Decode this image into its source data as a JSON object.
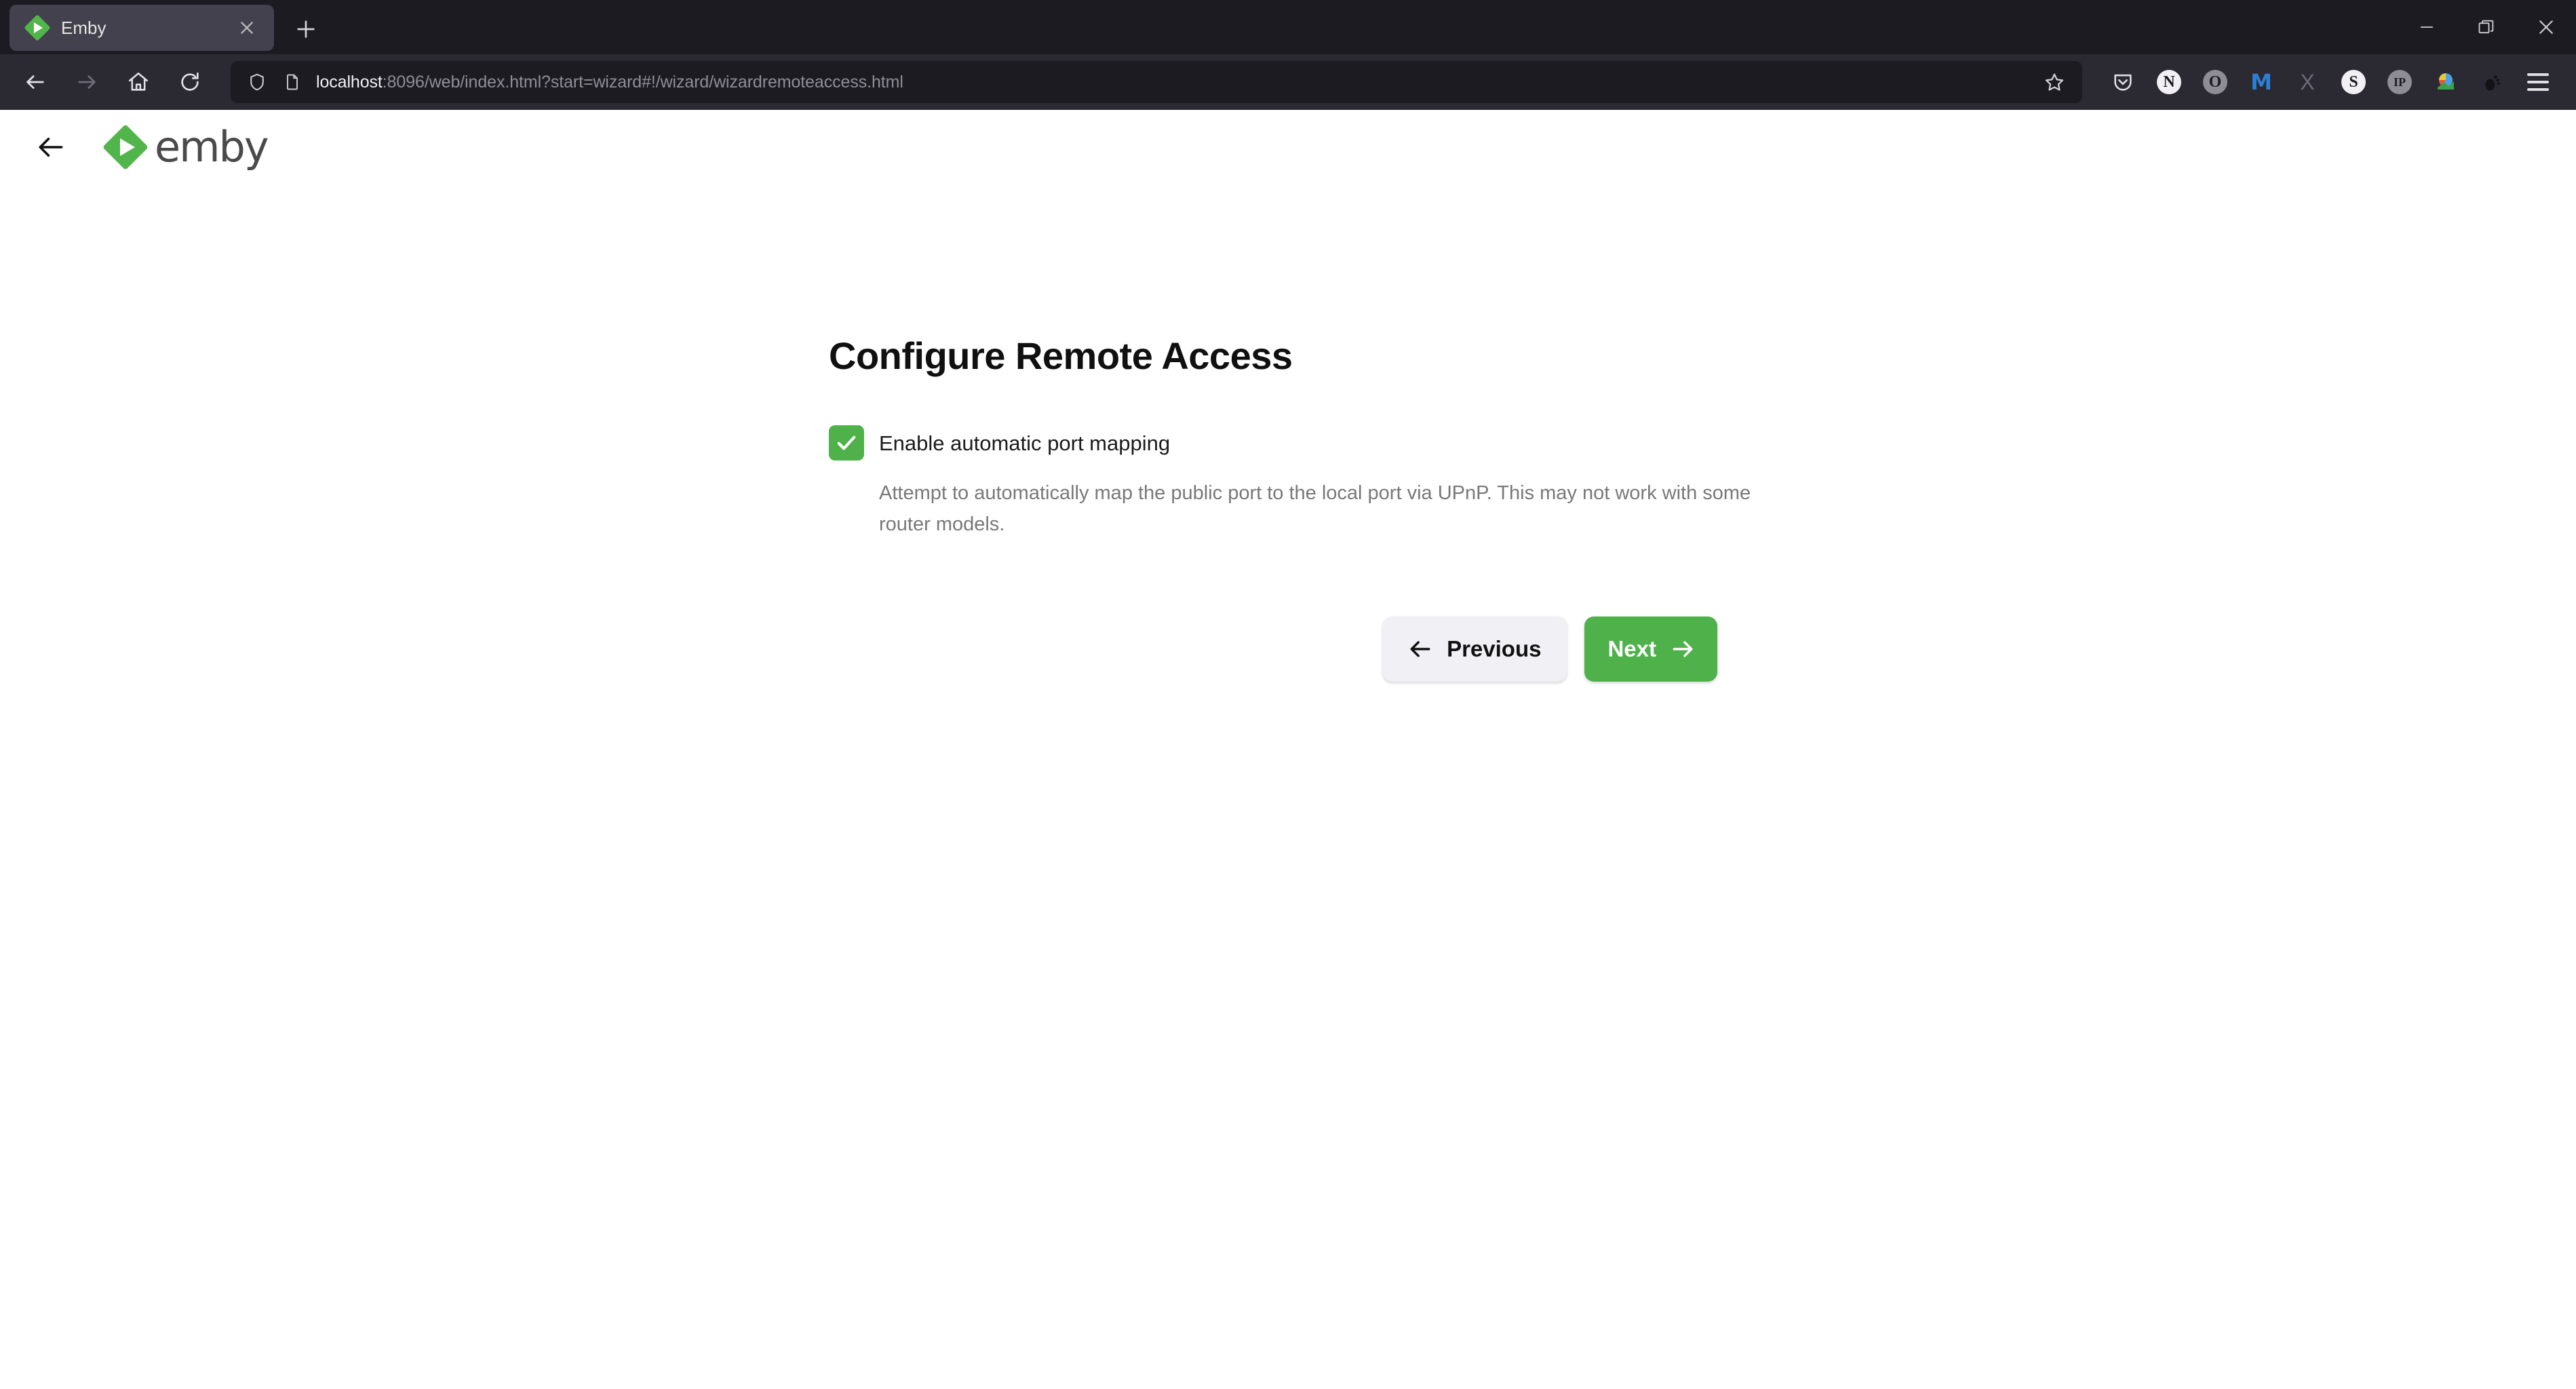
{
  "browser": {
    "tab": {
      "title": "Emby",
      "favicon_icon": "emby-diamond-icon",
      "close_icon": "close-icon"
    },
    "new_tab_label": "+",
    "window_controls": {
      "minimize_icon": "minimize-icon",
      "restore_icon": "restore-icon",
      "close_icon": "close-icon"
    },
    "nav": {
      "back_icon": "arrow-left-icon",
      "forward_icon": "arrow-right-icon",
      "home_icon": "home-icon",
      "reload_icon": "reload-icon"
    },
    "urlbar": {
      "shield_icon": "shield-icon",
      "page_icon": "page-document-icon",
      "host": "localhost",
      "path": ":8096/web/index.html?start=wizard#!/wizard/wizardremoteaccess.html",
      "bookmark_icon": "star-outline-icon"
    },
    "extensions": [
      {
        "name": "pocket-icon",
        "glyph": ""
      },
      {
        "name": "notion-icon",
        "glyph": "N"
      },
      {
        "name": "opera-o-icon",
        "glyph": "O"
      },
      {
        "name": "malwarebytes-icon",
        "glyph": "M"
      },
      {
        "name": "x-icon",
        "glyph": "X"
      },
      {
        "name": "s-extension-icon",
        "glyph": "S"
      },
      {
        "name": "ip-lookup-icon",
        "glyph": "IP"
      },
      {
        "name": "download-manager-icon",
        "glyph": ""
      },
      {
        "name": "gnome-foot-icon",
        "glyph": ""
      }
    ],
    "menu_icon": "hamburger-menu-icon"
  },
  "app": {
    "back_icon": "arrow-left-icon",
    "logo_text": "emby",
    "logo_mark": "emby-diamond-icon"
  },
  "wizard": {
    "title": "Configure Remote Access",
    "checkbox": {
      "checked": true,
      "label": "Enable automatic port mapping",
      "description": "Attempt to automatically map the public port to the local port via UPnP. This may not work with some router models.",
      "check_icon": "checkmark-icon"
    },
    "buttons": {
      "previous_label": "Previous",
      "previous_icon": "arrow-left-icon",
      "next_label": "Next",
      "next_icon": "arrow-right-icon"
    }
  },
  "colors": {
    "emby_green": "#4eb14a",
    "chrome_dark": "#1c1b22",
    "navbar_dark": "#2b2a33",
    "tab_active": "#42414d"
  }
}
